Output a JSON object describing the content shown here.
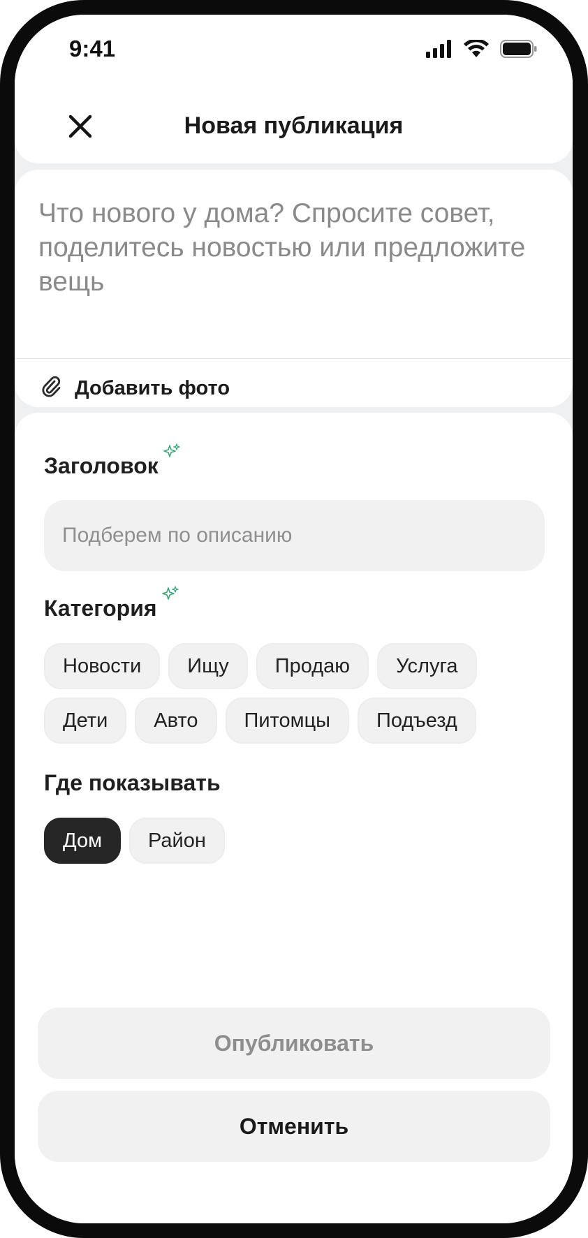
{
  "status_bar": {
    "time": "9:41",
    "icons": [
      "signal-icon",
      "wifi-icon",
      "battery-icon"
    ]
  },
  "header": {
    "title": "Новая публикация",
    "close_icon": "close-icon"
  },
  "compose": {
    "placeholder": "Что нового у дома? Спросите совет, поделитесь новостью или предложите вещь",
    "add_photo_label": "Добавить фото",
    "add_photo_icon": "paperclip-icon"
  },
  "form": {
    "title_section": {
      "label": "Заголовок",
      "placeholder": "Подберем по описанию",
      "value": ""
    },
    "category_section": {
      "label": "Категория",
      "row1": [
        "Новости",
        "Ищу",
        "Продаю",
        "Услуга"
      ],
      "row2": [
        "Дети",
        "Авто",
        "Питомцы",
        "Подъезд"
      ]
    },
    "visibility_section": {
      "label": "Где показывать",
      "options": [
        "Дом",
        "Район"
      ],
      "selected": "Дом"
    }
  },
  "actions": {
    "publish_label": "Опубликовать",
    "cancel_label": "Отменить"
  },
  "colors": {
    "accent_sparkle": "#3aa676",
    "chip_active_bg": "#262626",
    "chip_bg": "#f1f1f1",
    "screen_bg": "#eef0f2"
  }
}
